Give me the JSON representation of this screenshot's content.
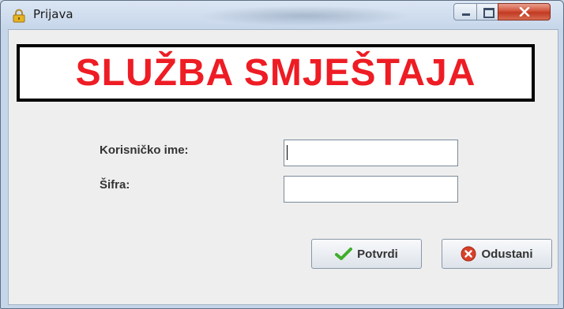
{
  "window": {
    "title": "Prijava",
    "title_icon": "lock-icon",
    "controls": [
      "minimize-icon",
      "maximize-icon",
      "close-icon"
    ]
  },
  "banner": {
    "text": "SLUŽBA SMJEŠTAJA",
    "color": "#ee1c24"
  },
  "form": {
    "username_label": "Korisničko ime:",
    "username_value": "",
    "password_label": "Šifra:",
    "password_value": ""
  },
  "buttons": {
    "confirm_label": "Potvrdi",
    "confirm_icon": "checkmark-icon",
    "cancel_label": "Odustani",
    "cancel_icon": "cancel-icon"
  },
  "colors": {
    "client_bg": "#eeeeee",
    "confirm_icon_color": "#3fae2a",
    "cancel_icon_color": "#d8402a"
  }
}
